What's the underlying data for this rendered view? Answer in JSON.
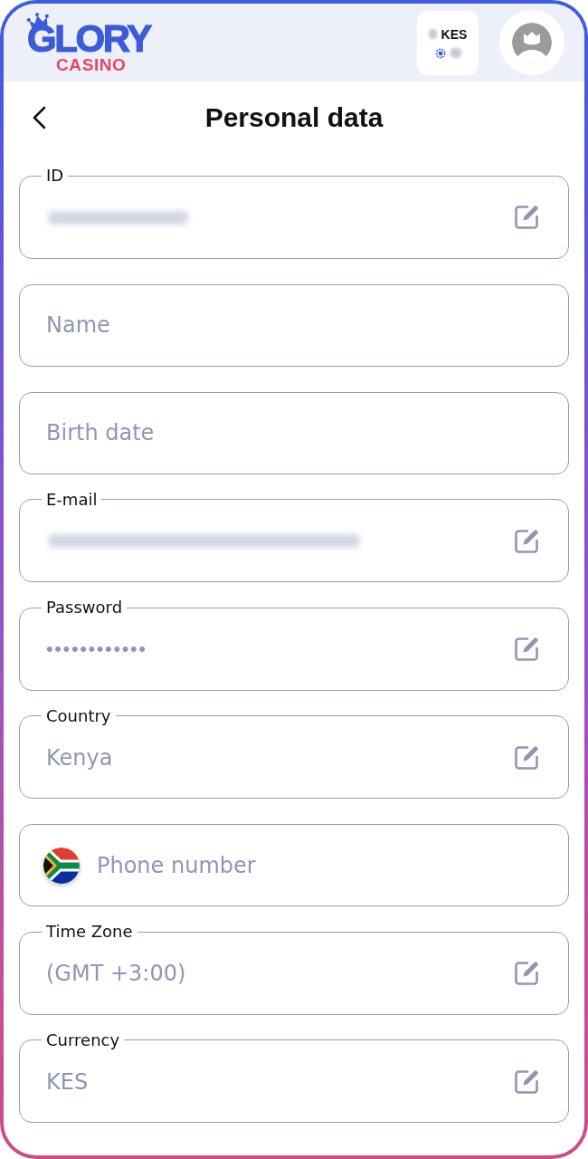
{
  "header": {
    "logo": {
      "title": "GLORY",
      "subtitle": "CASINO"
    },
    "balance": {
      "currency": "KES",
      "redacted": true
    }
  },
  "page": {
    "title": "Personal data"
  },
  "fields": [
    {
      "kind": "text",
      "label": "ID",
      "redacted": true,
      "editable": true
    },
    {
      "kind": "text",
      "placeholder": "Name",
      "redacted": false,
      "editable": false
    },
    {
      "kind": "text",
      "placeholder": "Birth date",
      "redacted": false,
      "editable": false
    },
    {
      "kind": "text",
      "label": "E-mail",
      "redacted": true,
      "editable": true
    },
    {
      "kind": "password",
      "label": "Password",
      "value": "••••••••••••",
      "redacted": false,
      "editable": true
    },
    {
      "kind": "text",
      "label": "Country",
      "value": "Kenya",
      "redacted": false,
      "editable": true
    },
    {
      "kind": "phone",
      "placeholder": "Phone number",
      "redacted": false,
      "editable": false
    },
    {
      "kind": "text",
      "label": "Time Zone",
      "value": "(GMT +3:00)",
      "redacted": false,
      "editable": true
    },
    {
      "kind": "text",
      "label": "Currency",
      "value": "KES",
      "redacted": false,
      "editable": true
    }
  ]
}
